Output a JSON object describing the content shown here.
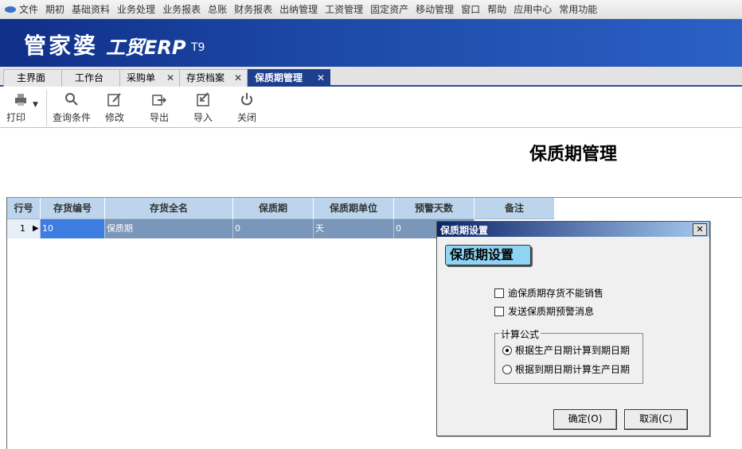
{
  "menu": [
    "文件",
    "期初",
    "基础资料",
    "业务处理",
    "业务报表",
    "总账",
    "财务报表",
    "出纳管理",
    "工资管理",
    "固定资产",
    "移动管理",
    "窗口",
    "帮助",
    "应用中心",
    "常用功能"
  ],
  "banner": {
    "brand": "管家婆",
    "product": "工贸ERP",
    "version": "T9"
  },
  "tabs": [
    {
      "label": "主界面",
      "closable": false,
      "active": false
    },
    {
      "label": "工作台",
      "closable": false,
      "active": false
    },
    {
      "label": "采购单",
      "closable": true,
      "active": false
    },
    {
      "label": "存货档案",
      "closable": true,
      "active": false
    },
    {
      "label": "保质期管理",
      "closable": true,
      "active": true
    }
  ],
  "tab_close_glyph": "✕",
  "toolbar": [
    {
      "label": "打印",
      "icon": "printer-icon"
    },
    {
      "label": "查询条件",
      "icon": "search-icon"
    },
    {
      "label": "修改",
      "icon": "edit-icon"
    },
    {
      "label": "导出",
      "icon": "export-icon"
    },
    {
      "label": "导入",
      "icon": "import-icon"
    },
    {
      "label": "关闭",
      "icon": "power-icon"
    }
  ],
  "page_title": "保质期管理",
  "grid": {
    "columns": [
      "行号",
      "存货编号",
      "存货全名",
      "保质期",
      "保质期单位",
      "预警天数",
      "备注"
    ],
    "rows": [
      {
        "row_no": "1",
        "cells": [
          "10",
          "保质期",
          "0",
          "天",
          "0"
        ]
      }
    ]
  },
  "dialog": {
    "title": "保质期设置",
    "close_glyph": "✕",
    "heading": "保质期设置",
    "options": [
      {
        "label": "逾保质期存货不能销售",
        "checked": false
      },
      {
        "label": "发送保质期预警消息",
        "checked": false
      }
    ],
    "formula_legend": "计算公式",
    "radios": [
      {
        "label": "根据生产日期计算到期日期",
        "selected": true
      },
      {
        "label": "根据到期日期计算生产日期",
        "selected": false
      }
    ],
    "ok_label": "确定(O)",
    "cancel_label": "取消(C)"
  },
  "colors": {
    "accent": "#1d3f8e",
    "grid_header": "#bcd4ec",
    "selection": "#3d7ce0"
  }
}
